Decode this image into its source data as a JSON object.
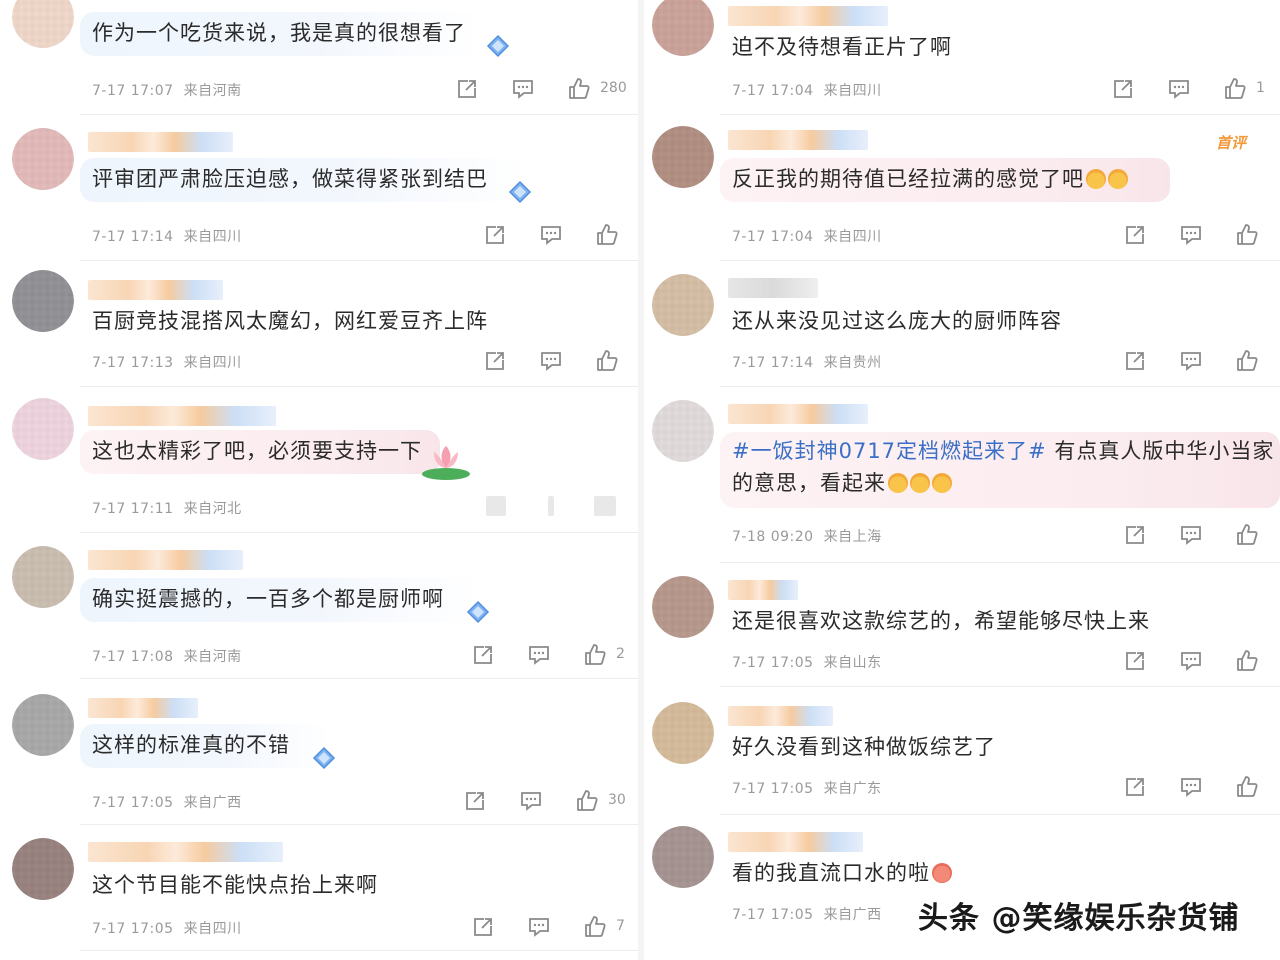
{
  "left_comments": [
    {
      "text": "作为一个吃货来说，我是真的很想看了",
      "time": "7-17 17:07",
      "location": "来自河南",
      "likes": "280"
    },
    {
      "text": "评审团严肃脸压迫感，做菜得紧张到结巴",
      "time": "7-17 17:14",
      "location": "来自四川",
      "likes": ""
    },
    {
      "text": "百厨竞技混搭风太魔幻，网红爱豆齐上阵",
      "time": "7-17 17:13",
      "location": "来自四川",
      "likes": ""
    },
    {
      "text": "这也太精彩了吧，必须要支持一下",
      "time": "7-17 17:11",
      "location": "来自河北",
      "likes": ""
    },
    {
      "text": "确实挺震撼的，一百多个都是厨师啊",
      "time": "7-17 17:08",
      "location": "来自河南",
      "likes": "2"
    },
    {
      "text": "这样的标准真的不错",
      "time": "7-17 17:05",
      "location": "来自广西",
      "likes": "30"
    },
    {
      "text": "这个节目能不能快点抬上来啊",
      "time": "7-17 17:05",
      "location": "来自四川",
      "likes": "7"
    }
  ],
  "right_comments": [
    {
      "text": "迫不及待想看正片了啊",
      "time": "7-17 17:04",
      "location": "来自四川",
      "likes": "1"
    },
    {
      "text": "反正我的期待值已经拉满的感觉了吧",
      "time": "7-17 17:04",
      "location": "来自四川",
      "likes": "",
      "badge": "首评"
    },
    {
      "text": "还从来没见过这么庞大的厨师阵容",
      "time": "7-17 17:14",
      "location": "来自贵州",
      "likes": ""
    },
    {
      "hashtag": "#一饭封神0717定档燃起来了#",
      "text": "有点真人版中华小当家",
      "text2": "的意思，看起来",
      "time": "7-18 09:20",
      "location": "来自上海",
      "likes": ""
    },
    {
      "text": "还是很喜欢这款综艺的，希望能够尽快上来",
      "time": "7-17 17:05",
      "location": "来自山东",
      "likes": ""
    },
    {
      "text": "好久没看到这种做饭综艺了",
      "time": "7-17 17:05",
      "location": "来自广东",
      "likes": ""
    },
    {
      "text": "看的我直流口水的啦",
      "time": "7-17 17:05",
      "location": "来自广西",
      "likes": ""
    }
  ],
  "watermark": "头条 @笑缘娱乐杂货铺",
  "colors": {
    "accent": "#3a6fc7",
    "meta": "#9a9a9a",
    "badge": "#f19a3e"
  },
  "icons": [
    "share-icon",
    "comment-icon",
    "like-icon",
    "diamond-sticker-icon",
    "lotus-sticker-icon"
  ]
}
